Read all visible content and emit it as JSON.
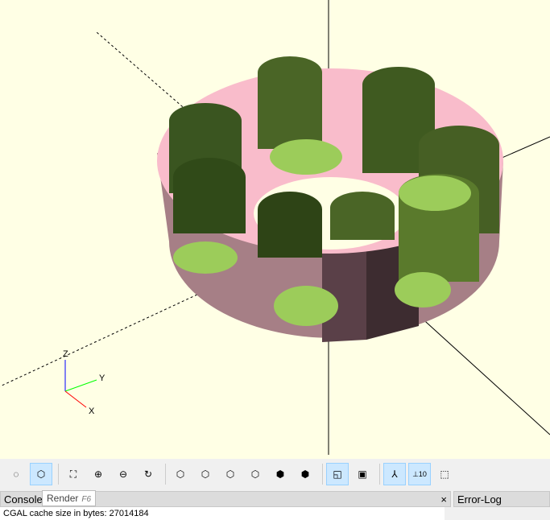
{
  "viewport": {
    "axis_labels": {
      "x": "X",
      "y": "Y",
      "z": "Z"
    },
    "colors": {
      "background": "#ffffe5",
      "top": "#f9bccb",
      "side": "#a67f86",
      "hole_floor": "#9ccc5a",
      "hole_wall": "#4a6526"
    }
  },
  "toolbar": {
    "buttons": [
      "preview",
      "render",
      "view-all",
      "zoom-in",
      "zoom-out",
      "reset-view",
      "view-right",
      "view-top",
      "view-bottom",
      "view-left",
      "view-front",
      "view-back",
      "perspective",
      "orthogonal",
      "show-axes",
      "show-scale-markers",
      "show-edges"
    ]
  },
  "tooltip": {
    "label": "Render",
    "shortcut": "F6"
  },
  "console": {
    "title": "Console",
    "close": "×",
    "lines": [
      "CGAL cache size in bytes: 27014184"
    ]
  },
  "error_log": {
    "title": "Error-Log"
  }
}
